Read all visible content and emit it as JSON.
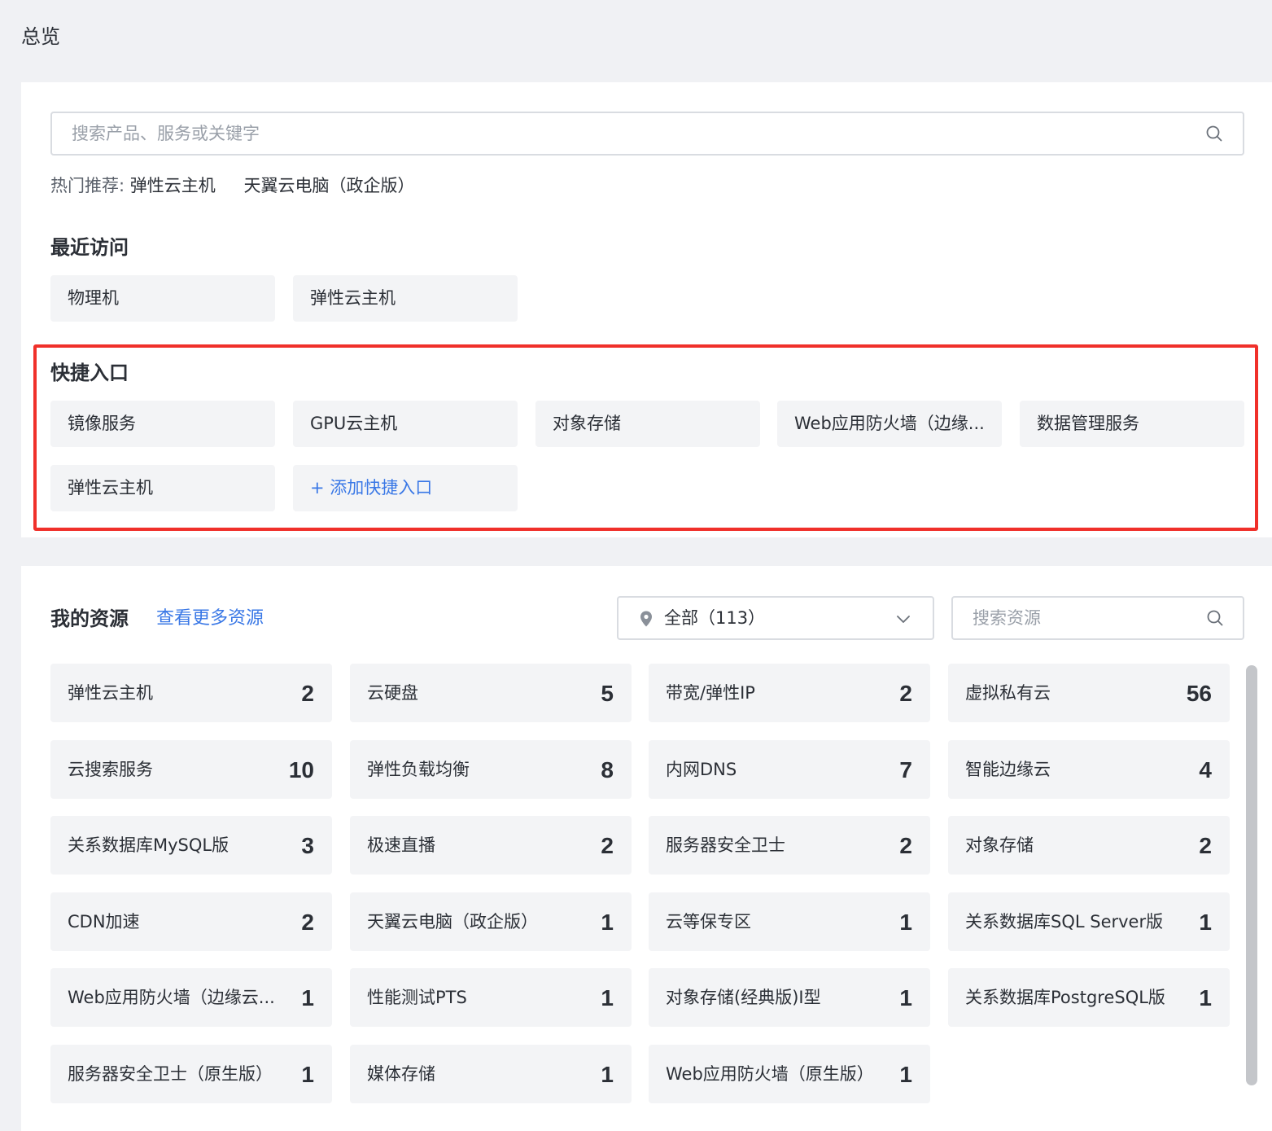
{
  "page": {
    "title": "总览"
  },
  "search": {
    "placeholder": "搜索产品、服务或关键字"
  },
  "hot": {
    "label": "热门推荐:",
    "items": [
      "弹性云主机",
      "天翼云电脑（政企版）"
    ]
  },
  "recent": {
    "title": "最近访问",
    "items": [
      "物理机",
      "弹性云主机"
    ]
  },
  "quick": {
    "title": "快捷入口",
    "items": [
      "镜像服务",
      "GPU云主机",
      "对象存储",
      "Web应用防火墙（边缘...",
      "数据管理服务",
      "弹性云主机"
    ],
    "add_label": "+ 添加快捷入口"
  },
  "resources": {
    "title": "我的资源",
    "more_link": "查看更多资源",
    "region_select": "全部（113）",
    "search_placeholder": "搜索资源",
    "items": [
      {
        "name": "弹性云主机",
        "count": "2"
      },
      {
        "name": "云硬盘",
        "count": "5"
      },
      {
        "name": "带宽/弹性IP",
        "count": "2"
      },
      {
        "name": "虚拟私有云",
        "count": "56"
      },
      {
        "name": "云搜索服务",
        "count": "10"
      },
      {
        "name": "弹性负载均衡",
        "count": "8"
      },
      {
        "name": "内网DNS",
        "count": "7"
      },
      {
        "name": "智能边缘云",
        "count": "4"
      },
      {
        "name": "关系数据库MySQL版",
        "count": "3"
      },
      {
        "name": "极速直播",
        "count": "2"
      },
      {
        "name": "服务器安全卫士",
        "count": "2"
      },
      {
        "name": "对象存储",
        "count": "2"
      },
      {
        "name": "CDN加速",
        "count": "2"
      },
      {
        "name": "天翼云电脑（政企版）",
        "count": "1"
      },
      {
        "name": "云等保专区",
        "count": "1"
      },
      {
        "name": "关系数据库SQL Server版",
        "count": "1"
      },
      {
        "name": "Web应用防火墙（边缘云...",
        "count": "1"
      },
      {
        "name": "性能测试PTS",
        "count": "1"
      },
      {
        "name": "对象存储(经典版)I型",
        "count": "1"
      },
      {
        "name": "关系数据库PostgreSQL版",
        "count": "1"
      },
      {
        "name": "服务器安全卫士（原生版）",
        "count": "1"
      },
      {
        "name": "媒体存储",
        "count": "1"
      },
      {
        "name": "Web应用防火墙（原生版）",
        "count": "1"
      }
    ]
  },
  "colors": {
    "accent": "#3a78e6",
    "highlight": "#f0302a",
    "tile_bg": "#f3f4f6",
    "page_bg": "#f0f1f4"
  }
}
